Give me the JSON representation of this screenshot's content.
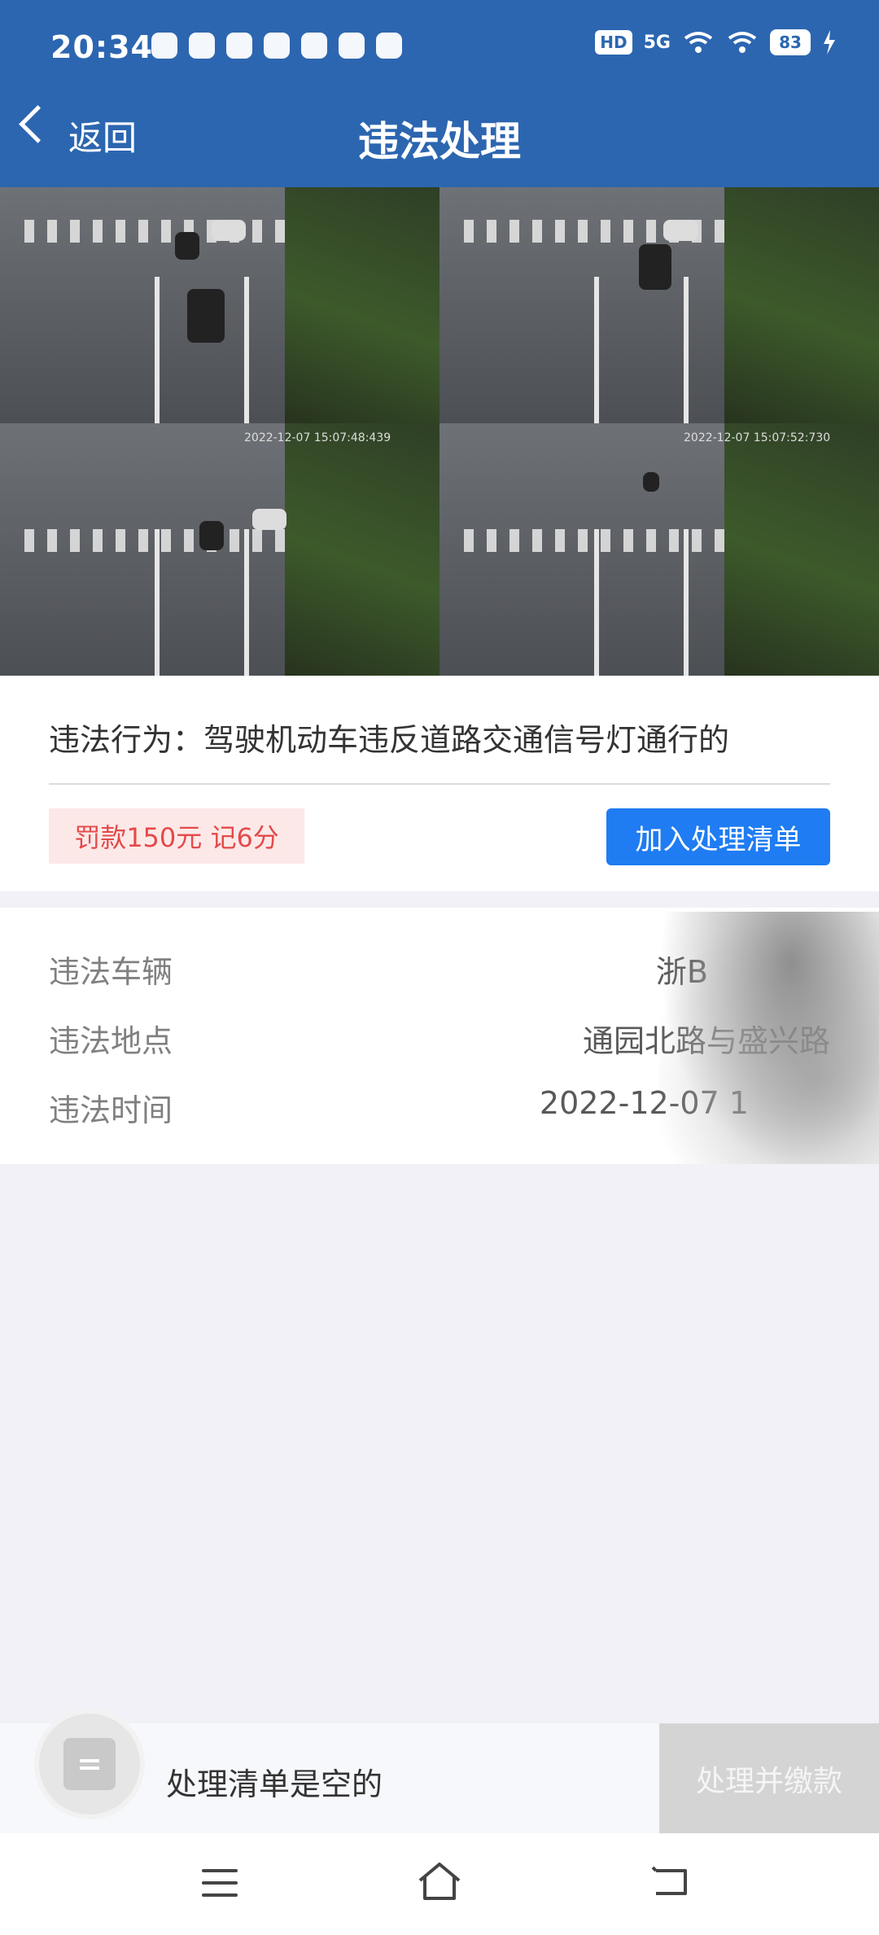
{
  "status_bar": {
    "time": "20:34",
    "network": "5G",
    "hd": "HD",
    "battery": "83"
  },
  "header": {
    "back_label": "返回",
    "title": "违法处理"
  },
  "violation": {
    "behavior": "违法行为：驾驶机动车违反道路交通信号灯通行的",
    "fine_tag": "罚款150元 记6分",
    "add_button": "加入处理清单"
  },
  "photos": {
    "timestamp_1": "2022-12-07 15:07:48:439",
    "timestamp_2": "2022-12-07 15:07:52:730"
  },
  "details": {
    "rows": [
      {
        "label": "违法车辆",
        "value": "浙B"
      },
      {
        "label": "违法地点",
        "value": "通园北路与盛兴路"
      },
      {
        "label": "违法时间",
        "value": "2022-12-07 1"
      }
    ]
  },
  "bottom": {
    "empty_text": "处理清单是空的",
    "pay_button": "处理并缴款"
  },
  "colors": {
    "header": "#2c66b0",
    "primary_button": "#1f7cf2",
    "fine_text": "#e34a4a",
    "fine_bg": "#fde8e8"
  },
  "icons": {
    "back": "chevron-left-icon",
    "cart": "list-icon",
    "nav_menu": "menu-icon",
    "nav_home": "home-icon",
    "nav_back": "back-icon"
  }
}
